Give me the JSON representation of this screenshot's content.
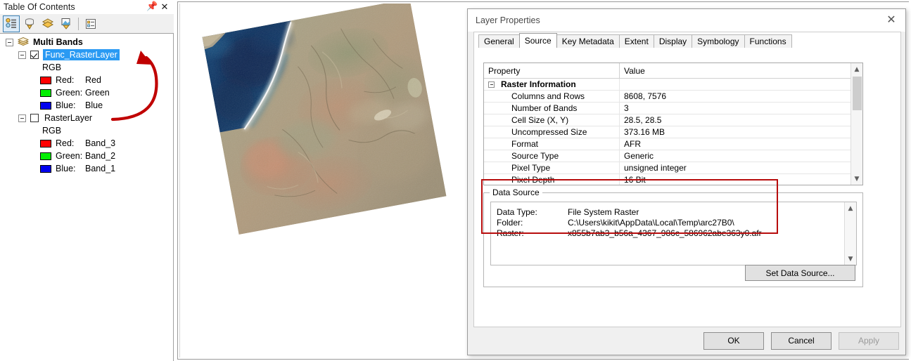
{
  "toc": {
    "title": "Table Of Contents",
    "pin_icon": "pin-icon",
    "close_icon": "close-icon",
    "toolbar": [
      {
        "name": "list-by-drawing-order",
        "label": "List By Drawing Order",
        "active": true
      },
      {
        "name": "list-by-source",
        "label": "List By Source",
        "active": false
      },
      {
        "name": "list-by-visibility",
        "label": "List By Visibility",
        "active": false
      },
      {
        "name": "list-by-selection",
        "label": "List By Selection",
        "active": false
      },
      {
        "name": "options",
        "label": "Options",
        "active": false
      }
    ],
    "group": {
      "label": "Multi Bands",
      "expanded": true
    },
    "layers": [
      {
        "label": "Func_RasterLayer",
        "checked": true,
        "selected": true,
        "renderer": "RGB",
        "bands": [
          {
            "channel": "Red:",
            "value": "Red",
            "color": "#ff0000"
          },
          {
            "channel": "Green:",
            "value": "Green",
            "color": "#00ee00"
          },
          {
            "channel": "Blue:",
            "value": "Blue",
            "color": "#0000ee"
          }
        ]
      },
      {
        "label": "RasterLayer",
        "checked": false,
        "selected": false,
        "renderer": "RGB",
        "bands": [
          {
            "channel": "Red:",
            "value": "Band_3",
            "color": "#ff0000"
          },
          {
            "channel": "Green:",
            "value": "Band_2",
            "color": "#00ee00"
          },
          {
            "channel": "Blue:",
            "value": "Band_1",
            "color": "#0000ee"
          }
        ]
      }
    ],
    "annotation_arrow_color": "#c00000"
  },
  "dialog": {
    "title": "Layer Properties",
    "close_icon": "close-icon",
    "tabs": [
      {
        "label": "General",
        "active": false
      },
      {
        "label": "Source",
        "active": true
      },
      {
        "label": "Key Metadata",
        "active": false
      },
      {
        "label": "Extent",
        "active": false
      },
      {
        "label": "Display",
        "active": false
      },
      {
        "label": "Symbology",
        "active": false
      },
      {
        "label": "Functions",
        "active": false
      }
    ],
    "property_grid": {
      "headers": [
        "Property",
        "Value"
      ],
      "group_label": "Raster Information",
      "rows": [
        {
          "property": "Columns and Rows",
          "value": "8608, 7576"
        },
        {
          "property": "Number of Bands",
          "value": "3"
        },
        {
          "property": "Cell Size (X, Y)",
          "value": "28.5, 28.5"
        },
        {
          "property": "Uncompressed Size",
          "value": "373.16 MB"
        },
        {
          "property": "Format",
          "value": "AFR"
        },
        {
          "property": "Source Type",
          "value": "Generic"
        },
        {
          "property": "Pixel Type",
          "value": "unsigned integer"
        },
        {
          "property": "Pixel Depth",
          "value": "16 Bit"
        }
      ]
    },
    "data_source": {
      "legend": "Data Source",
      "lines": [
        {
          "key": "Data Type:",
          "value": "File System Raster"
        },
        {
          "key": "Folder:",
          "value": "C:\\Users\\kikit\\AppData\\Local\\Temp\\arc27B0\\"
        },
        {
          "key": "Raster:",
          "value": "x855b7ab3_b56a_4367_986c_586962abe363y0.afr"
        }
      ],
      "set_button": "Set Data Source...",
      "highlight_color": "#b70c0c"
    },
    "footer": [
      {
        "label": "OK",
        "name": "ok-button",
        "disabled": false
      },
      {
        "label": "Cancel",
        "name": "cancel-button",
        "disabled": false
      },
      {
        "label": "Apply",
        "name": "apply-button",
        "disabled": true
      }
    ]
  },
  "map": {
    "name": "map-view",
    "scene_description": "Rotated Landsat satellite scene: dark blue ocean upper-left, white surf coastline, tan and brown arid terrain"
  }
}
